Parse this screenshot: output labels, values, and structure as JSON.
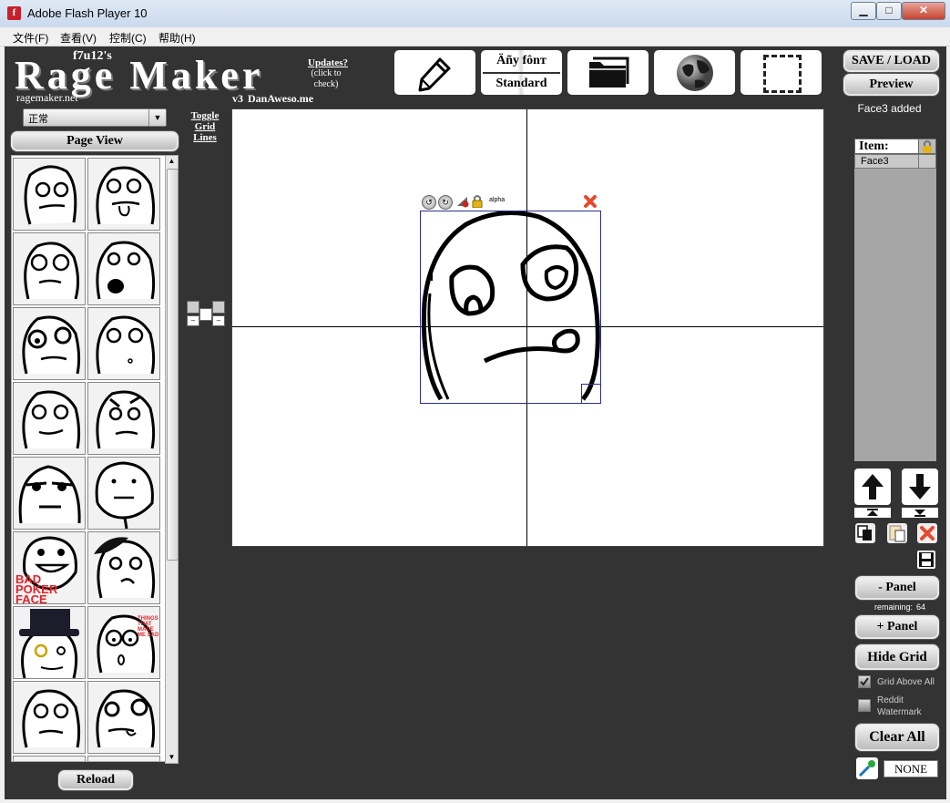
{
  "window": {
    "title": "Adobe Flash Player 10",
    "minimize_label": "▁",
    "maximize_label": "□",
    "close_label": "✕"
  },
  "menu": [
    "文件(F)",
    "查看(V)",
    "控制(C)",
    "帮助(H)"
  ],
  "header": {
    "author": "f7u12's",
    "title": "Rage Maker",
    "site": "ragemaker.net",
    "updates_link": "Updates?",
    "updates_note": "(click to check)",
    "version": "v3",
    "credit": "DanAweso.me"
  },
  "left_panel": {
    "category_value": "正常",
    "page_view_label": "Page View",
    "reload_label": "Reload",
    "face_captions": {
      "poker": "BAD POKER FACE",
      "things": "THINGS THAT MADE ME SAD"
    }
  },
  "grid_toggle": {
    "label": "Toggle Grid Lines"
  },
  "toolbar": {
    "font_label": "Äñy fônт",
    "font_value": "Standard",
    "save_load_label": "SAVE / LOAD",
    "preview_label": "Preview"
  },
  "status": {
    "message": "Face3 added"
  },
  "canvas": {
    "selected_item_alpha_label": "alpha"
  },
  "items_panel": {
    "header_label": "Item:",
    "items": [
      "Face3"
    ]
  },
  "right_panel": {
    "minus_panel_label": "- Panel",
    "remaining_label": "remaining:",
    "remaining_value": "64",
    "plus_panel_label": "+ Panel",
    "hide_grid_label": "Hide Grid",
    "grid_above_all_label": "Grid Above All",
    "reddit_watermark_label": "Reddit Watermark",
    "clear_all_label": "Clear All",
    "color_value": "NONE"
  },
  "colors": {
    "stage_bg": "#333333",
    "canvas_bg": "#ffffff",
    "delete_red": "#e54a2f"
  }
}
